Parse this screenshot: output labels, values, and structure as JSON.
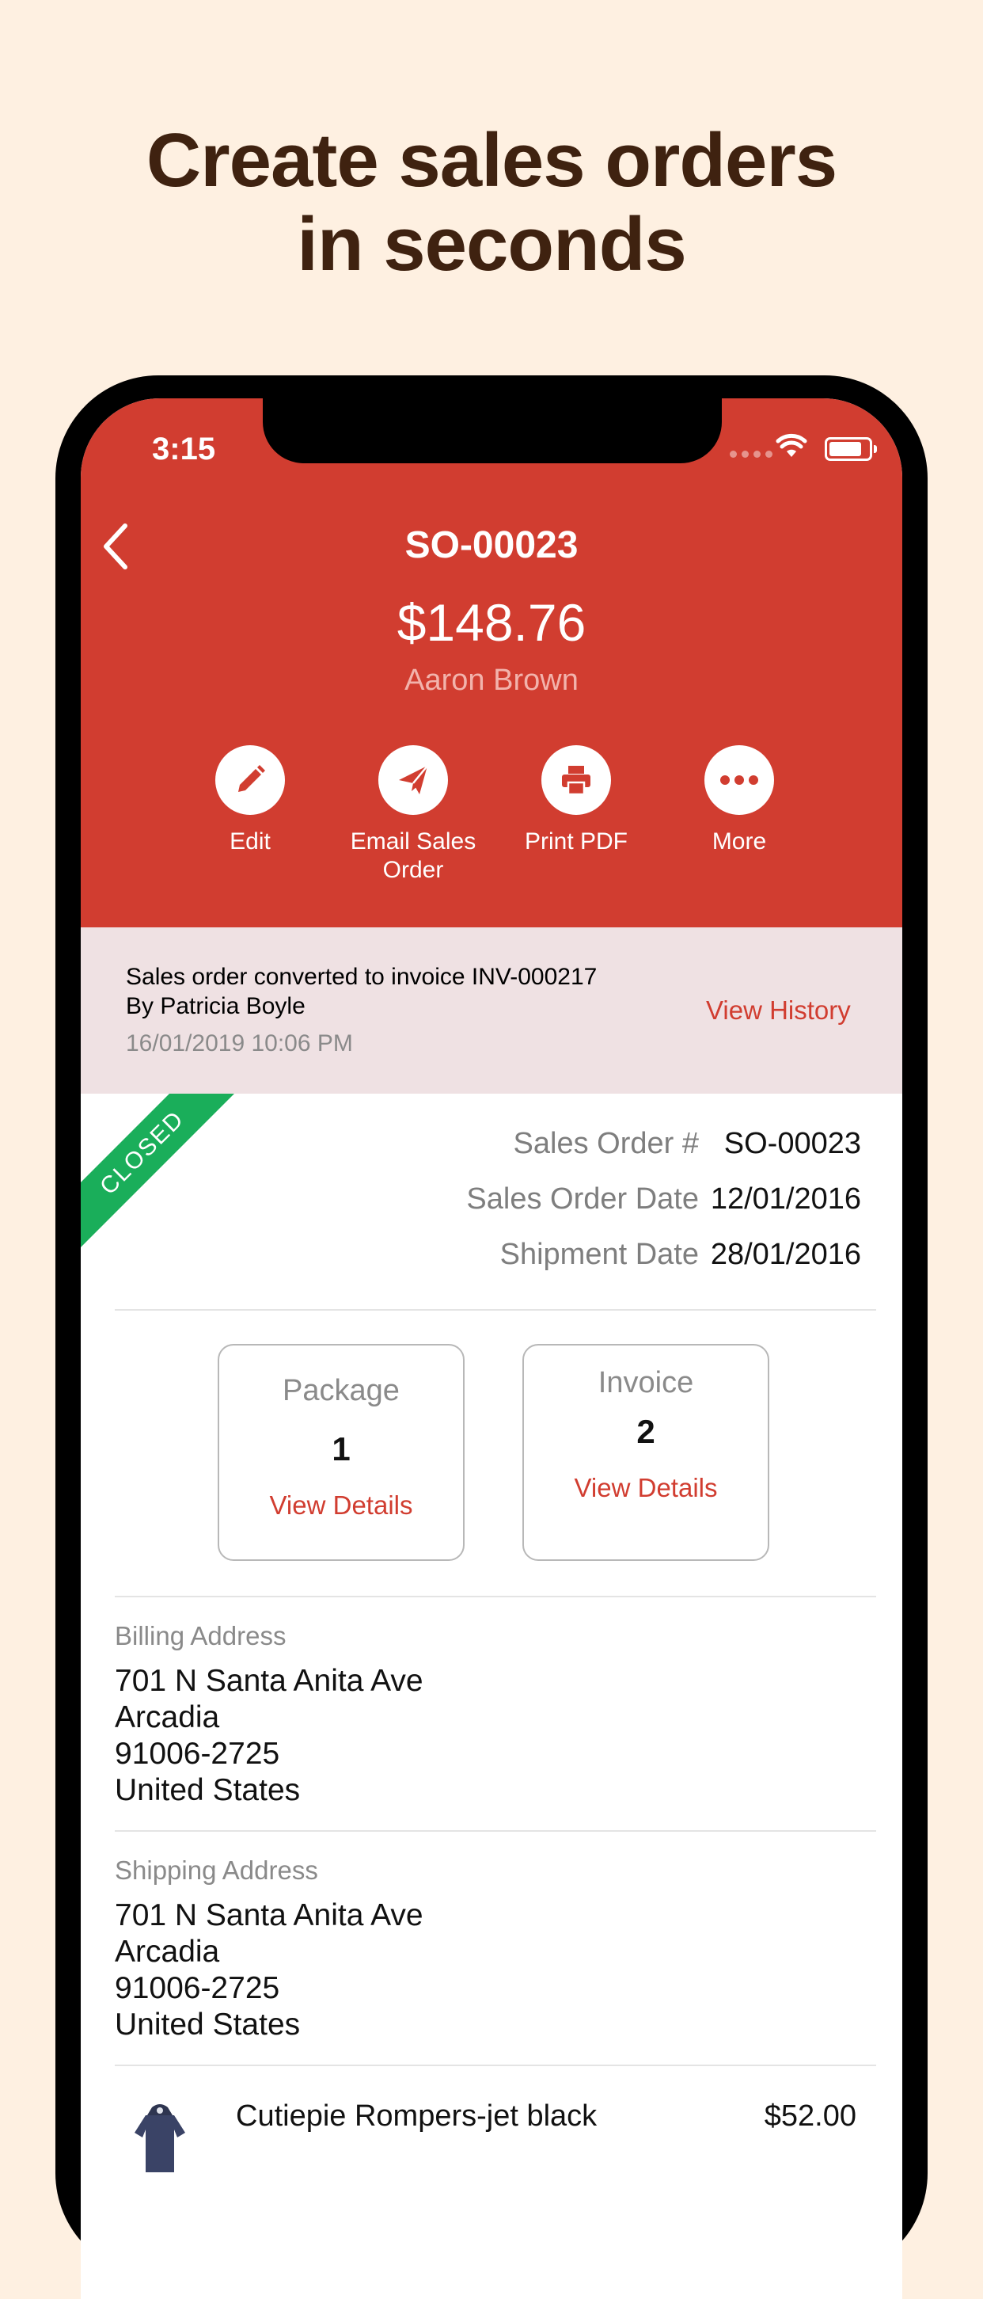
{
  "headline": {
    "line1": "Create sales orders",
    "line2": "in seconds"
  },
  "status_bar": {
    "time": "3:15"
  },
  "header": {
    "order_id": "SO-00023",
    "amount": "$148.76",
    "customer": "Aaron Brown",
    "back_icon": "chevron-left-icon",
    "actions": [
      {
        "icon": "pencil-icon",
        "label": "Edit"
      },
      {
        "icon": "paper-plane-icon",
        "label_line1": "Email Sales",
        "label_line2": "Order"
      },
      {
        "icon": "printer-icon",
        "label": "Print PDF"
      },
      {
        "icon": "more-dots-icon",
        "label": "More"
      }
    ]
  },
  "notice": {
    "line1": "Sales order converted to invoice INV-000217",
    "line2": "By Patricia Boyle",
    "date": "16/01/2019 10:06 PM",
    "link": "View History"
  },
  "status_ribbon": "CLOSED",
  "info": [
    {
      "label": "Sales Order #",
      "value": "SO-00023"
    },
    {
      "label": "Sales Order Date",
      "value": "12/01/2016"
    },
    {
      "label": "Shipment Date",
      "value": "28/01/2016"
    }
  ],
  "cards": [
    {
      "title": "Package",
      "count": "1",
      "link": "View Details"
    },
    {
      "title": "Invoice",
      "count": "2",
      "link": "View Details"
    }
  ],
  "billing": {
    "label": "Billing Address",
    "lines": [
      "701 N Santa Anita Ave",
      "Arcadia",
      "91006-2725",
      "United States"
    ]
  },
  "shipping": {
    "label": "Shipping Address",
    "lines": [
      "701 N Santa Anita Ave",
      "Arcadia",
      "91006-2725",
      "United States"
    ]
  },
  "item": {
    "name": "Cutiepie Rompers-jet black",
    "price": "$52.00"
  },
  "colors": {
    "brand_red": "#d13d30",
    "background": "#fef0e1",
    "headline": "#3f2210",
    "closed_green": "#1aae5a",
    "notice_bg": "#efe1e3"
  }
}
